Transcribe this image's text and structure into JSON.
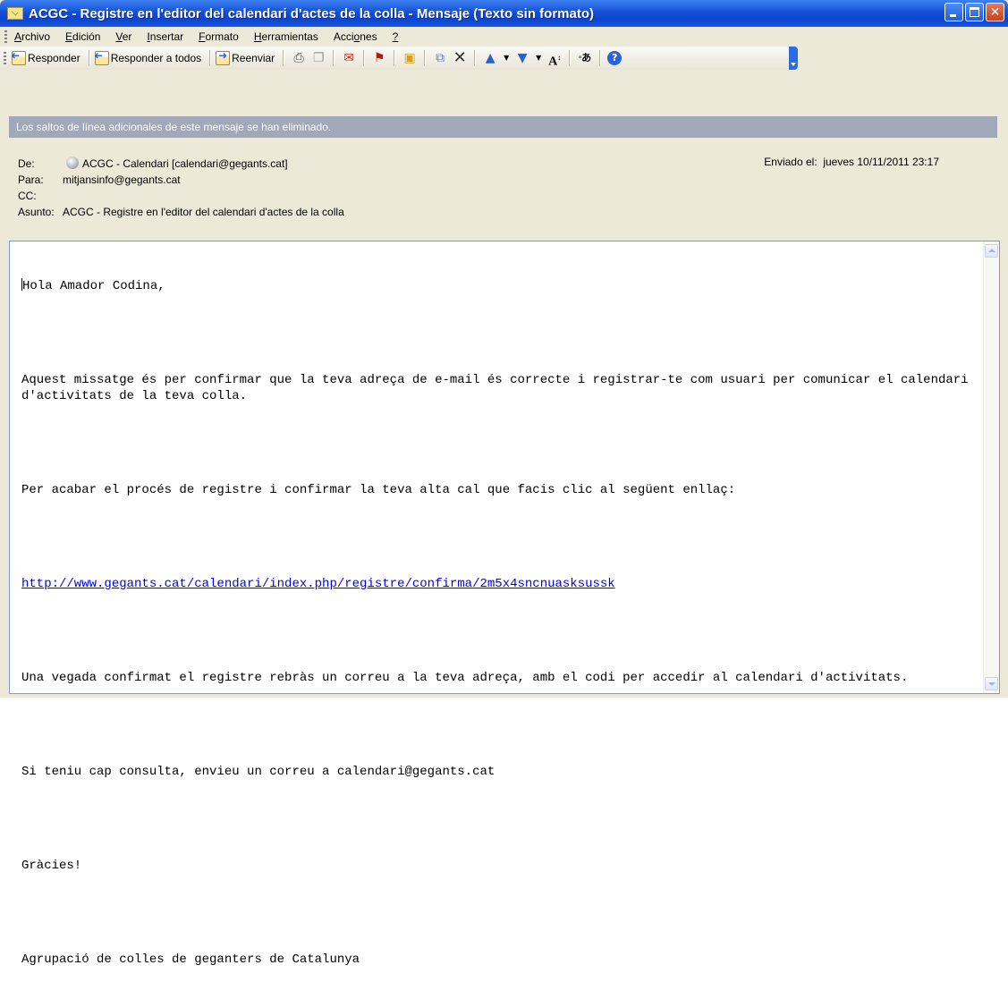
{
  "window": {
    "title": "ACGC - Registre en l'editor del calendari d'actes de la colla - Mensaje (Texto sin formato)"
  },
  "menu": {
    "items": [
      {
        "name": "Archivo",
        "u": "A",
        "rest": "rchivo"
      },
      {
        "name": "Edición",
        "u": "E",
        "rest": "dición"
      },
      {
        "name": "Ver",
        "u": "V",
        "rest": "er"
      },
      {
        "name": "Insertar",
        "u": "I",
        "rest": "nsertar"
      },
      {
        "name": "Formato",
        "u": "F",
        "rest": "ormato"
      },
      {
        "name": "Herramientas",
        "u": "H",
        "rest": "erramientas"
      },
      {
        "name": "Acciones",
        "pre": "Acci",
        "u": "o",
        "rest": "nes"
      },
      {
        "name": "?",
        "u": "?",
        "rest": ""
      }
    ]
  },
  "toolbar": {
    "reply_label": "Responder",
    "reply_all_label": "Responder a todos",
    "forward_label": "Reenviar",
    "icons": [
      "printer-icon",
      "copy-icon",
      "envelope-icon",
      "flag-icon",
      "open-folder-icon",
      "move-to-folder-icon",
      "delete-icon",
      "previous-item-icon",
      "next-item-icon",
      "font-size-icon",
      "translate-icon",
      "help-icon"
    ]
  },
  "infobar": {
    "text": "Los saltos de línea adicionales de este mensaje se han eliminado."
  },
  "header": {
    "from_label": "De:",
    "from_value": "ACGC - Calendari [calendari@gegants.cat]",
    "to_label": "Para:",
    "to_value": "mitjansinfo@gegants.cat",
    "cc_label": "CC:",
    "cc_value": "",
    "subject_label": "Asunto:",
    "subject_value": "ACGC - Registre en l'editor del calendari d'actes de la colla",
    "sent_label": "Enviado el:",
    "sent_value": "jueves 10/11/2011 23:17"
  },
  "message": {
    "greeting": "Hola Amador Codina,",
    "para1": "Aquest missatge és per confirmar que la teva adreça de e-mail és correcte i registrar-te com usuari per comunicar el calendari d'activitats de la teva colla.",
    "para2": "Per acabar el procés de registre i confirmar la teva alta cal que facis clic al següent enllaç:",
    "link": "http://www.gegants.cat/calendari/index.php/registre/confirma/2m5x4sncnuasksussk",
    "para3": "Una vegada confirmat el registre rebràs un correu a la teva adreça, amb el codi per accedir al calendari d'activitats.",
    "para4": "Si teniu cap consulta, envieu un correu a calendari@gegants.cat",
    "thanks": "Gràcies!",
    "signature": "Agrupació de colles de geganters de Catalunya"
  },
  "colors": {
    "titlebar": "#0b44cf",
    "infobar": "#a0a8ba",
    "link": "#0000ee"
  }
}
